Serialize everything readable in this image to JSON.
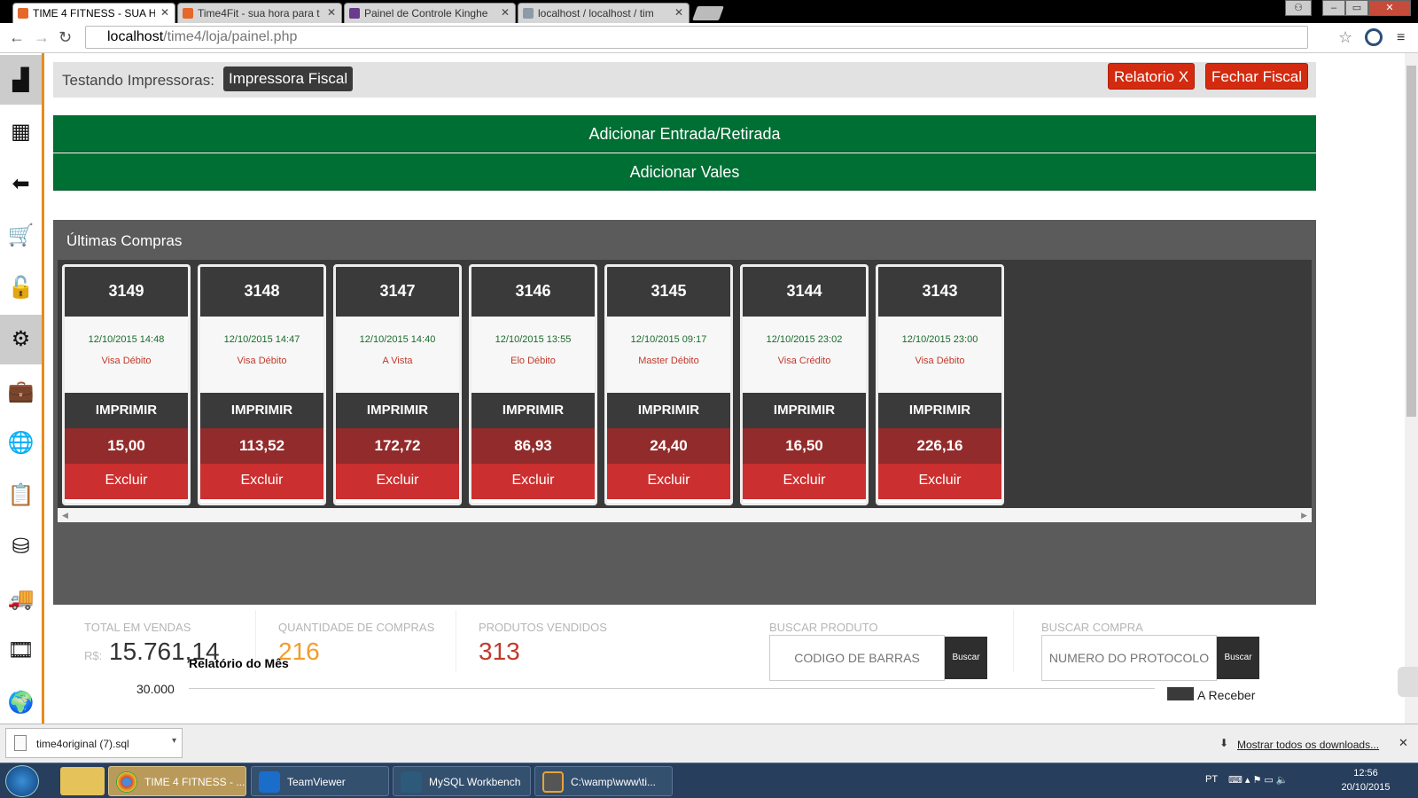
{
  "browser": {
    "tabs": [
      {
        "label": "TIME 4 FITNESS - SUA HO",
        "active": true
      },
      {
        "label": "Time4Fit - sua hora para t",
        "active": false
      },
      {
        "label": "Painel de Controle Kinghe",
        "active": false
      },
      {
        "label": "localhost / localhost / tim",
        "active": false
      }
    ],
    "url_host": "localhost",
    "url_path": "/time4/loja/painel.php"
  },
  "sidebar": {
    "items": [
      {
        "icon": "factory-icon",
        "glyph": "▟",
        "active": true
      },
      {
        "icon": "grid-icon",
        "glyph": "▦",
        "active": false
      },
      {
        "icon": "arrow-left-icon",
        "glyph": "⬅",
        "active": false
      },
      {
        "icon": "cart-icon",
        "glyph": "🛒",
        "active": false
      },
      {
        "icon": "unlock-icon",
        "glyph": "🔓",
        "active": false
      },
      {
        "icon": "gear-icon",
        "glyph": "⚙",
        "active": true
      },
      {
        "icon": "briefcase-icon",
        "glyph": "💼",
        "active": false
      },
      {
        "icon": "globe-icon",
        "glyph": "🌐",
        "active": false
      },
      {
        "icon": "clipboard-icon",
        "glyph": "📋",
        "active": false
      },
      {
        "icon": "coins-icon",
        "glyph": "⛁",
        "active": false
      },
      {
        "icon": "truck-icon",
        "glyph": "🚚",
        "active": false
      },
      {
        "icon": "film-icon",
        "glyph": "🎞",
        "active": false
      },
      {
        "icon": "world-icon",
        "glyph": "🌍",
        "active": false
      }
    ]
  },
  "topbar": {
    "label": "Testando Impressoras:",
    "chip": "Impressora Fiscal",
    "btn_relatorio": "Relatorio X",
    "btn_fechar": "Fechar Fiscal"
  },
  "actions": {
    "entrada": "Adicionar Entrada/Retirada",
    "vales": "Adicionar Vales"
  },
  "compras": {
    "title": "Últimas Compras",
    "print_label": "IMPRIMIR",
    "delete_label": "Excluir",
    "cards": [
      {
        "num": "3149",
        "date": "12/10/2015 14:48",
        "pay": "Visa Débito",
        "value": "15,00"
      },
      {
        "num": "3148",
        "date": "12/10/2015 14:47",
        "pay": "Visa Débito",
        "value": "113,52"
      },
      {
        "num": "3147",
        "date": "12/10/2015 14:40",
        "pay": "A Vista",
        "value": "172,72"
      },
      {
        "num": "3146",
        "date": "12/10/2015 13:55",
        "pay": "Elo Débito",
        "value": "86,93"
      },
      {
        "num": "3145",
        "date": "12/10/2015 09:17",
        "pay": "Master Débito",
        "value": "24,40"
      },
      {
        "num": "3144",
        "date": "12/10/2015 23:02",
        "pay": "Visa Crédito",
        "value": "16,50"
      },
      {
        "num": "3143",
        "date": "12/10/2015 23:00",
        "pay": "Visa Débito",
        "value": "226,16"
      }
    ]
  },
  "stats": {
    "total_label": "TOTAL EM VENDAS",
    "total_prefix": "R$:",
    "total_value": "15.761,14",
    "qtd_label": "QUANTIDADE DE COMPRAS",
    "qtd_value": "216",
    "prod_label": "PRODUTOS VENDIDOS",
    "prod_value": "313",
    "colors": {
      "qtd": "#f39c2b",
      "prod": "#c0392b"
    }
  },
  "search": {
    "produto_label": "BUSCAR PRODUTO",
    "produto_placeholder": "CODIGO DE BARRAS",
    "compra_label": "BUSCAR COMPRA",
    "compra_placeholder": "NUMERO DO PROTOCOLO",
    "button": "Buscar"
  },
  "chart_data": {
    "type": "bar",
    "title": "Relatório do Mês",
    "y_ticks": [
      "30.000"
    ],
    "series": [
      {
        "name": "A Receber",
        "values": []
      }
    ]
  },
  "downloads": {
    "file": "time4original (7).sql",
    "show_all": "Mostrar todos os downloads..."
  },
  "taskbar": {
    "tasks": [
      {
        "label": "TIME 4 FITNESS - ...",
        "active": true
      },
      {
        "label": "TeamViewer",
        "active": false
      },
      {
        "label": "MySQL Workbench",
        "active": false
      },
      {
        "label": "C:\\wamp\\www\\ti...",
        "active": false
      }
    ],
    "lang": "PT",
    "time": "12:56",
    "date": "20/10/2015"
  }
}
